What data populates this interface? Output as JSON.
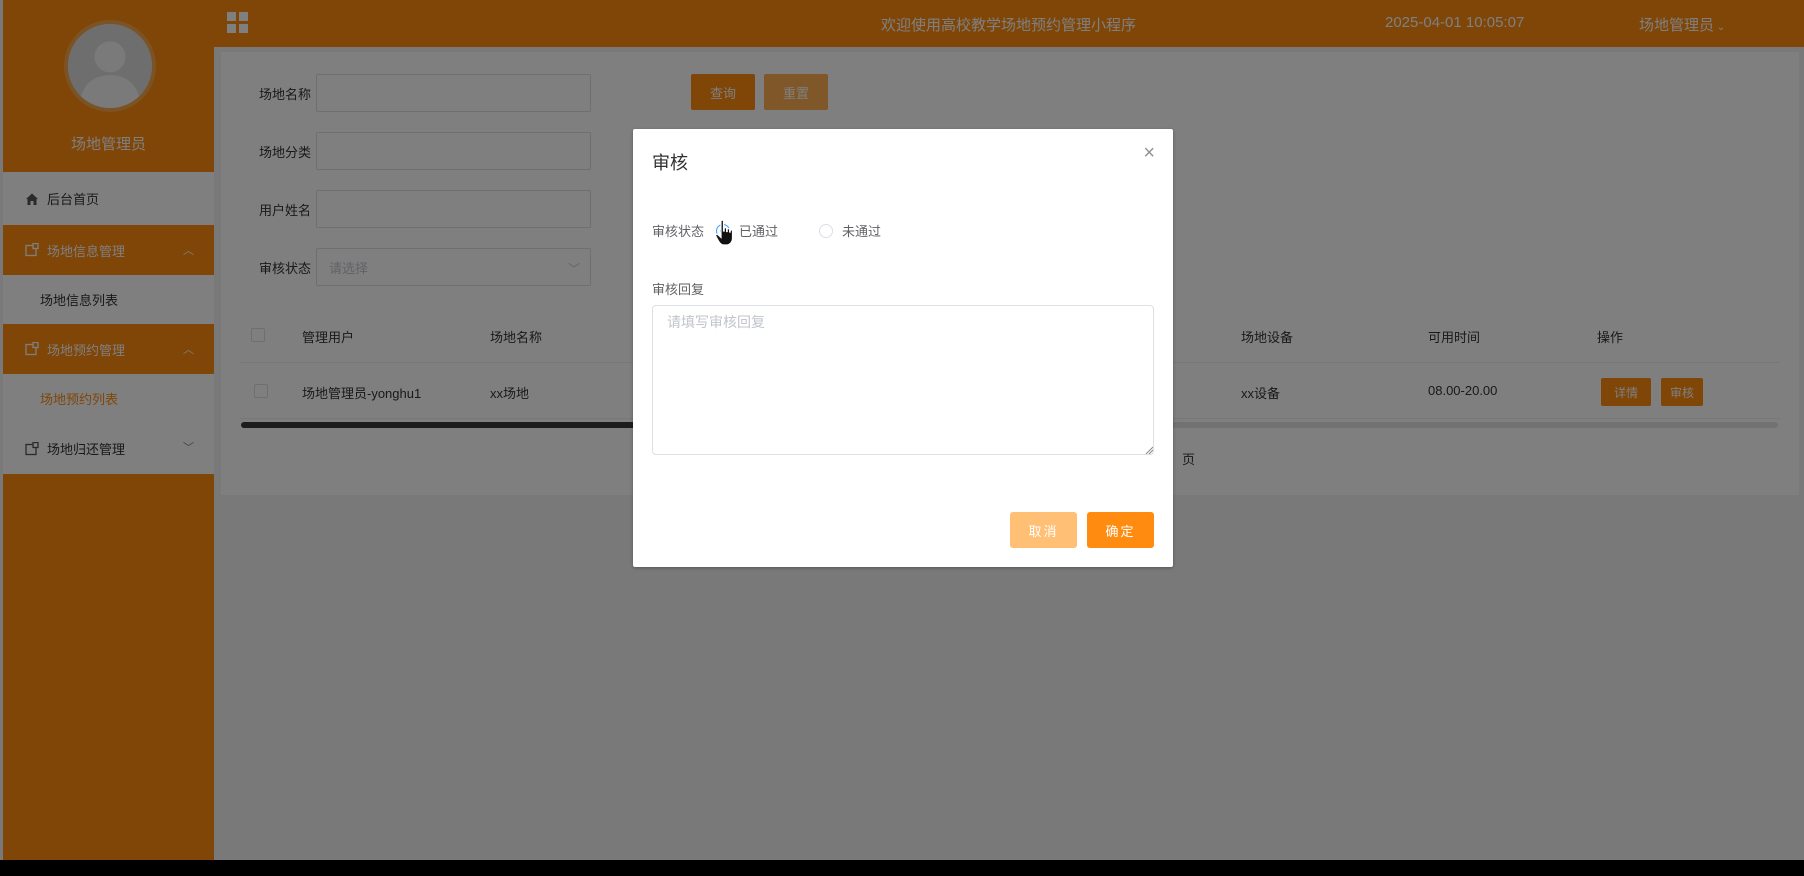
{
  "sidebar": {
    "role_name": "场地管理员",
    "home": "后台首页",
    "groups": [
      {
        "label": "场地信息管理",
        "chevron": "^",
        "sub": "场地信息列表",
        "active": false
      },
      {
        "label": "场地预约管理",
        "chevron": "^",
        "sub": "场地预约列表",
        "active": true
      },
      {
        "label": "场地归还管理",
        "chevron": "v"
      }
    ]
  },
  "header": {
    "welcome": "欢迎使用高校教学场地预约管理小程序",
    "datetime": "2025-04-01 10:05:07",
    "user": "场地管理员"
  },
  "filters": {
    "venue_name_label": "场地名称",
    "venue_category_label": "场地分类",
    "user_name_label": "用户姓名",
    "review_status_label": "审核状态",
    "review_status_placeholder": "请选择",
    "query_button": "查询",
    "reset_button": "重置"
  },
  "table": {
    "headers": [
      "管理用户",
      "场地名称",
      "场地设备",
      "可用时间",
      "操作"
    ],
    "rows": [
      {
        "user": "场地管理员-yonghu1",
        "venue": "xx场地",
        "equipment": "xx设备",
        "time": "08.00-20.00"
      }
    ],
    "detail_button": "详情",
    "review_button": "审核"
  },
  "pagination": {
    "suffix": "页"
  },
  "dialog": {
    "title": "审核",
    "close": "×",
    "status_label": "审核状态",
    "option_passed": "已通过",
    "option_failed": "未通过",
    "selected": "已通过",
    "reply_label": "审核回复",
    "reply_placeholder": "请填写审核回复",
    "cancel": "取消",
    "confirm": "确定"
  },
  "colors": {
    "primary": "#ff8c10",
    "primary_light": "#ffbf74",
    "radio": "#409eff"
  }
}
